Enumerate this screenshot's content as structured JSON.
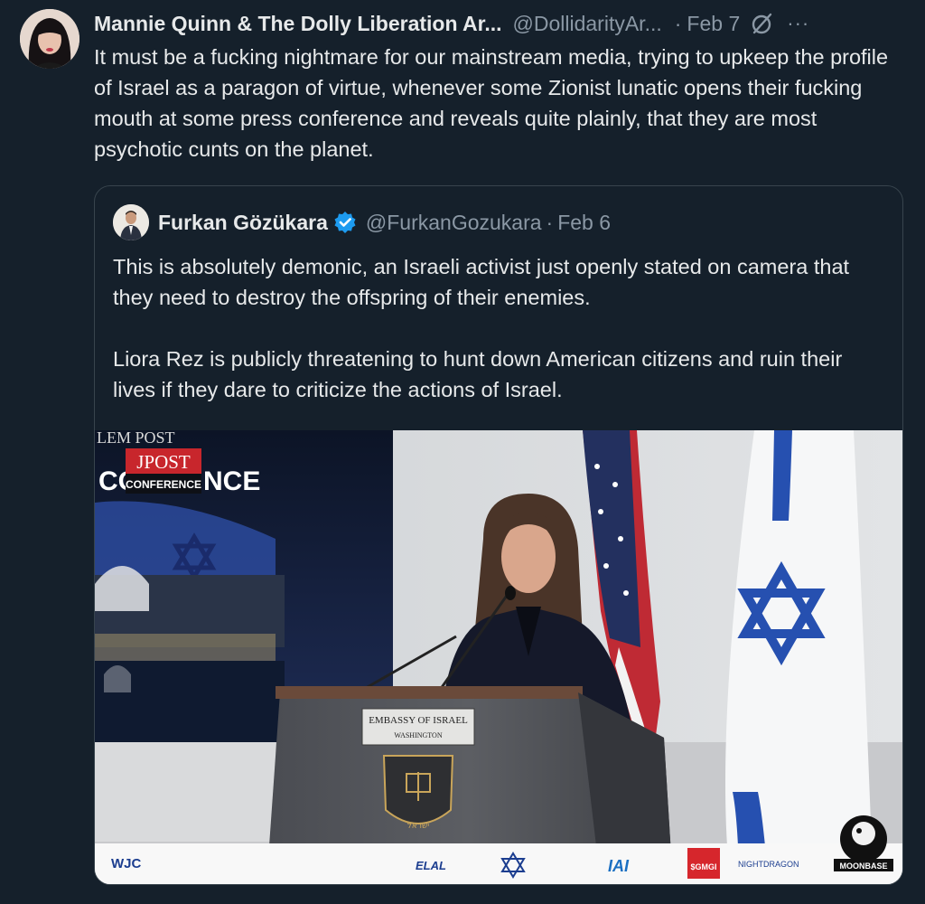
{
  "tweet": {
    "author_name": "Mannie Quinn & The Dolly Liberation Ar...",
    "author_handle": "@DollidarityAr...",
    "separator": "·",
    "date": "Feb 7",
    "more_label": "···",
    "text": "It must be a fucking nightmare for our mainstream media, trying to upkeep the profile of Israel as a paragon of virtue, whenever some Zionist lunatic opens their fucking mouth at some press conference and reveals quite plainly, that they are most psychotic cunts on the planet."
  },
  "quoted": {
    "author_name": "Furkan Gözükara",
    "author_handle": "@FurkanGozukara",
    "separator": "·",
    "date": "Feb 6",
    "paragraphs": [
      "This is absolutely demonic, an Israeli activist just openly stated on camera that they need to destroy the offspring of their enemies.",
      "Liora Rez is publicly threatening to hunt down American citizens and ruin their lives if they dare to criticize the actions of Israel."
    ],
    "media": {
      "screen_top_text": "LEM POST",
      "screen_left_text": "CO",
      "screen_right_text": "NCE",
      "logo_top": "JPOST",
      "logo_bottom": "CONFERENCE",
      "podium_sign_line1": "EMBASSY OF ISRAEL",
      "podium_sign_line2": "WASHINGTON",
      "podium_emblem_text": "ישראל",
      "sponsor_logos": [
        "WJC",
        "ELAL",
        "IAI",
        "$GMGI",
        "NIGHTDRAGON"
      ],
      "watermark": "MOONBASE"
    }
  },
  "colors": {
    "background": "#15202b",
    "border": "#38444d",
    "text_primary": "#e7e9ea",
    "text_secondary": "#8b98a5",
    "verified": "#1d9bf0",
    "israel_blue": "#1f3f9a"
  }
}
